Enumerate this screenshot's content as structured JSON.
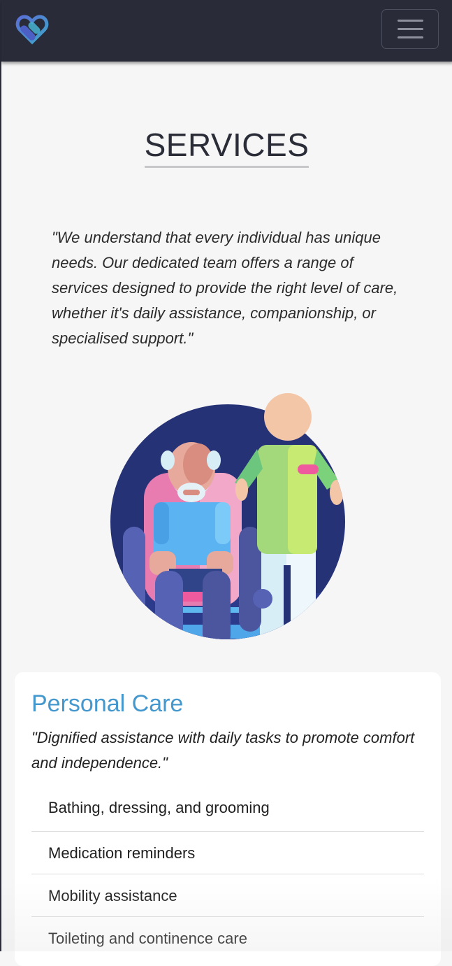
{
  "header": {
    "logo_icon": "heart-logo-icon",
    "menu_icon": "hamburger-menu-icon",
    "background": "#292b38"
  },
  "page": {
    "title": "SERVICES",
    "intro": "\"We understand that every individual has unique needs. Our dedicated team offers a range of services designed to provide the right level of care, whether it's daily assistance, companionship, or specialised support.\""
  },
  "illustration": {
    "icon": "caregiver-with-elderly-person-illustration"
  },
  "services": [
    {
      "title": "Personal Care",
      "tagline": "\"Dignified assistance with daily tasks to promote comfort and independence.\"",
      "items": [
        "Bathing, dressing, and grooming",
        "Medication reminders",
        "Mobility assistance",
        "Toileting and continence care"
      ]
    }
  ],
  "colors": {
    "accent": "#4598cd",
    "navbar": "#292b38",
    "background": "#f6f6f6"
  }
}
